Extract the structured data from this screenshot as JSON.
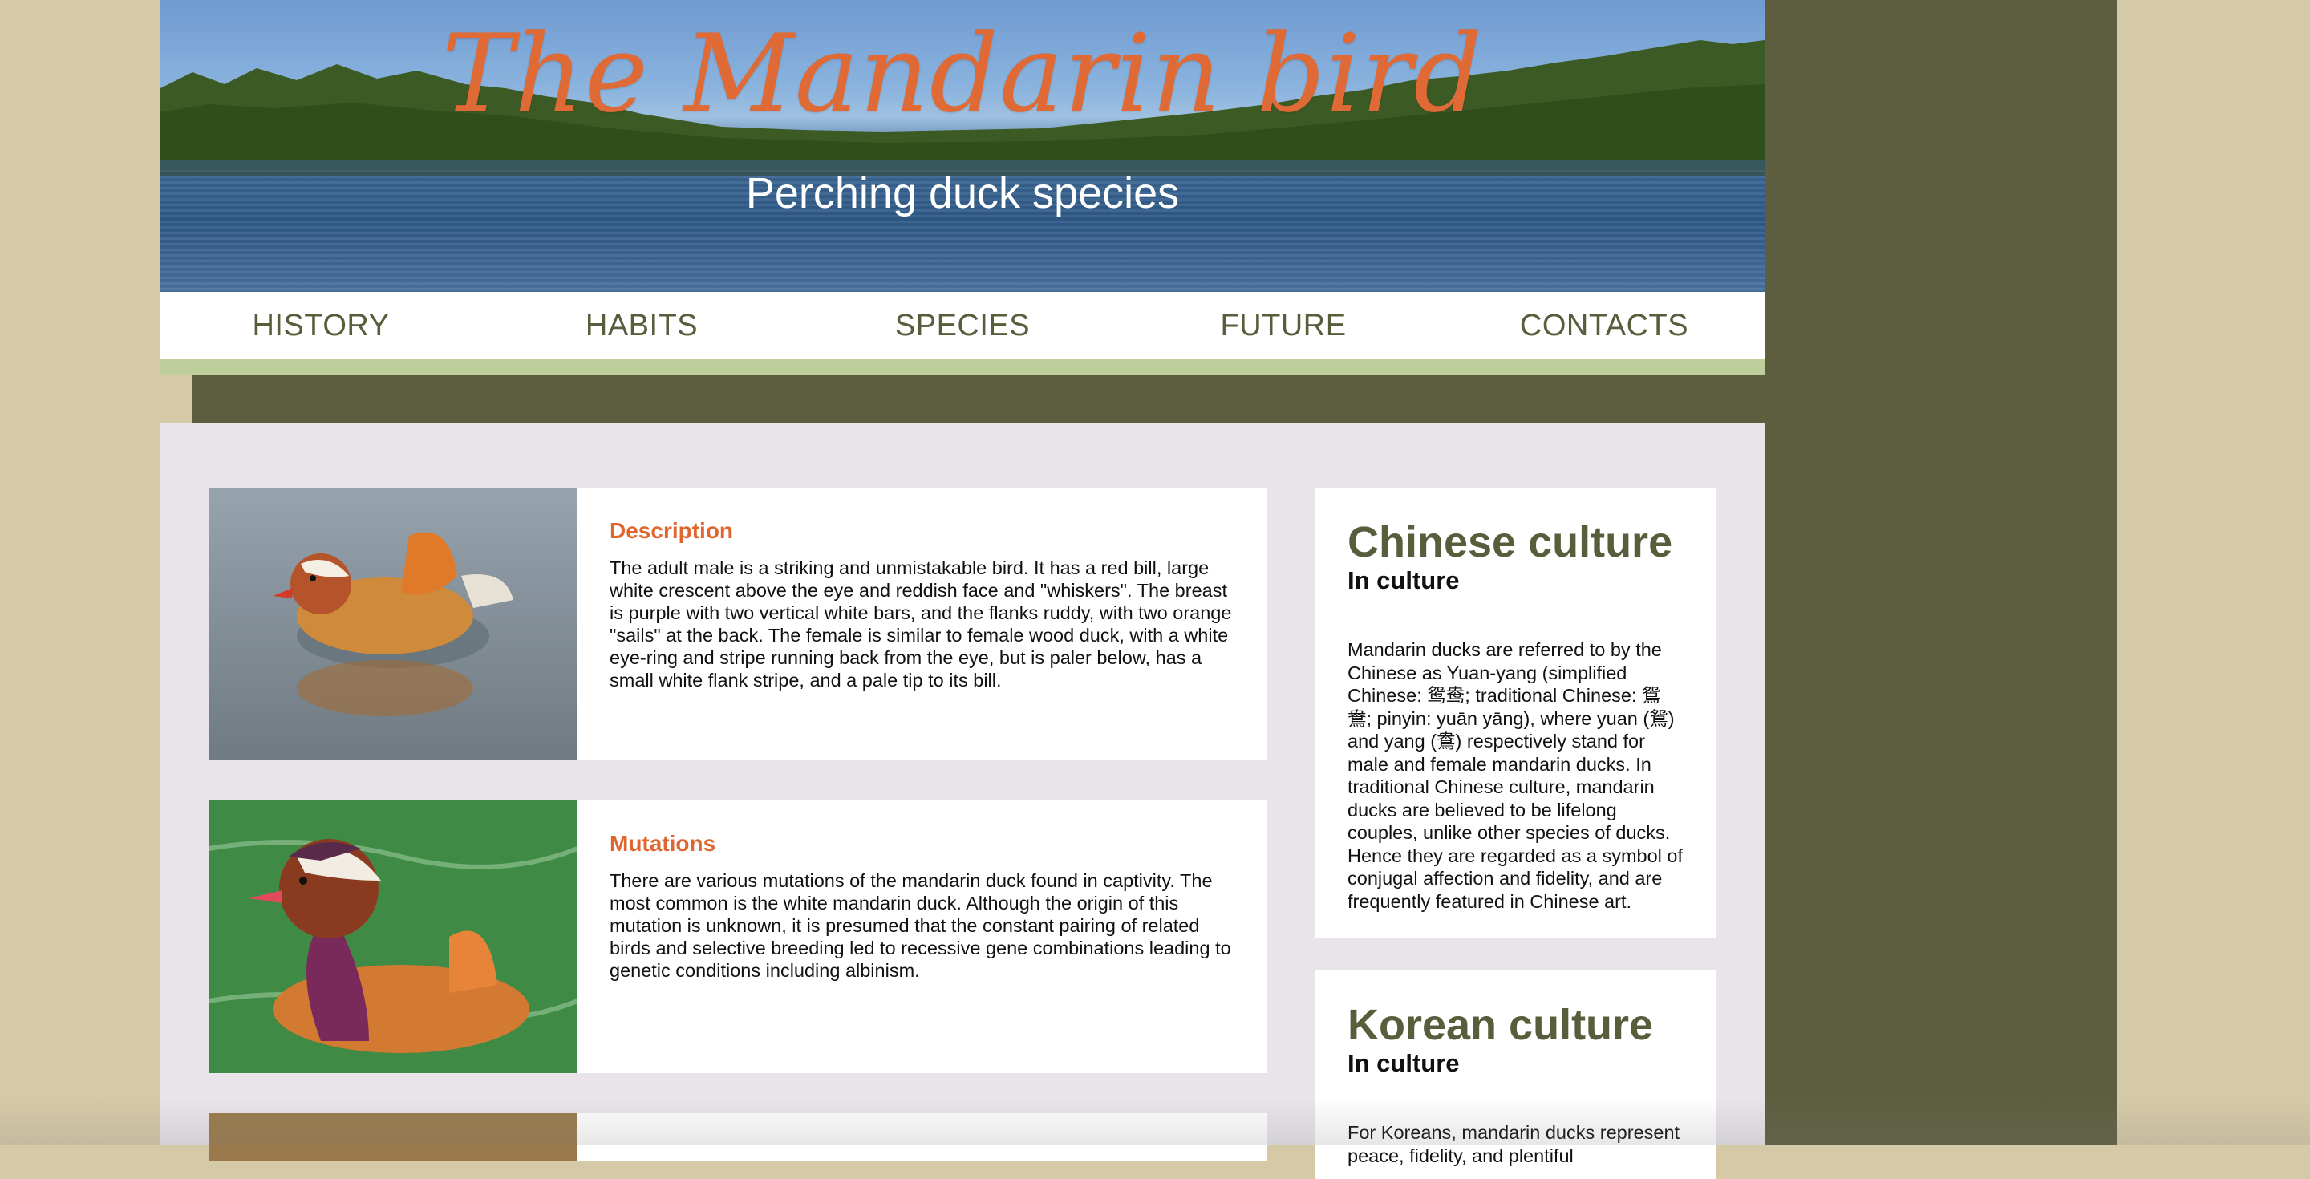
{
  "header": {
    "title": "The Mandarin bird",
    "subtitle": "Perching duck species"
  },
  "nav": {
    "items": [
      {
        "label": "HISTORY"
      },
      {
        "label": "HABITS"
      },
      {
        "label": "SPECIES"
      },
      {
        "label": "FUTURE"
      },
      {
        "label": "CONTACTS"
      }
    ]
  },
  "articles": [
    {
      "heading": "Description",
      "body": "The adult male is a striking and unmistakable bird. It has a red bill, large white crescent above the eye and reddish face and \"whiskers\". The breast is purple with two vertical white bars, and the flanks ruddy, with two orange \"sails\" at the back. The female is similar to female wood duck, with a white eye-ring and stripe running back from the eye, but is paler below, has a small white flank stripe, and a pale tip to its bill."
    },
    {
      "heading": "Mutations",
      "body": "There are various mutations of the mandarin duck found in captivity. The most common is the white mandarin duck. Although the origin of this mutation is unknown, it is presumed that the constant pairing of related birds and selective breeding led to recessive gene combinations leading to genetic conditions including albinism."
    }
  ],
  "sidebar": [
    {
      "title": "Chinese culture",
      "subtitle": "In culture",
      "body": "Mandarin ducks are referred to by the Chinese as Yuan-yang (simplified Chinese: 鸳鸯; traditional Chinese: 鴛鴦; pinyin: yuān yāng), where yuan (鴛) and yang (鴦) respectively stand for male and female mandarin ducks. In traditional Chinese culture, mandarin ducks are believed to be lifelong couples, unlike other species of ducks. Hence they are regarded as a symbol of conjugal affection and fidelity, and are frequently featured in Chinese art."
    },
    {
      "title": "Korean culture",
      "subtitle": "In culture",
      "body": "For Koreans, mandarin ducks represent peace, fidelity, and plentiful"
    }
  ],
  "colors": {
    "accent": "#e06a35",
    "olive": "#5a5d3b",
    "nav_strip": "#bfcf9c",
    "background": "#d6c9a8",
    "frame": "#5d5e3f",
    "content": "#e8e4ea"
  }
}
